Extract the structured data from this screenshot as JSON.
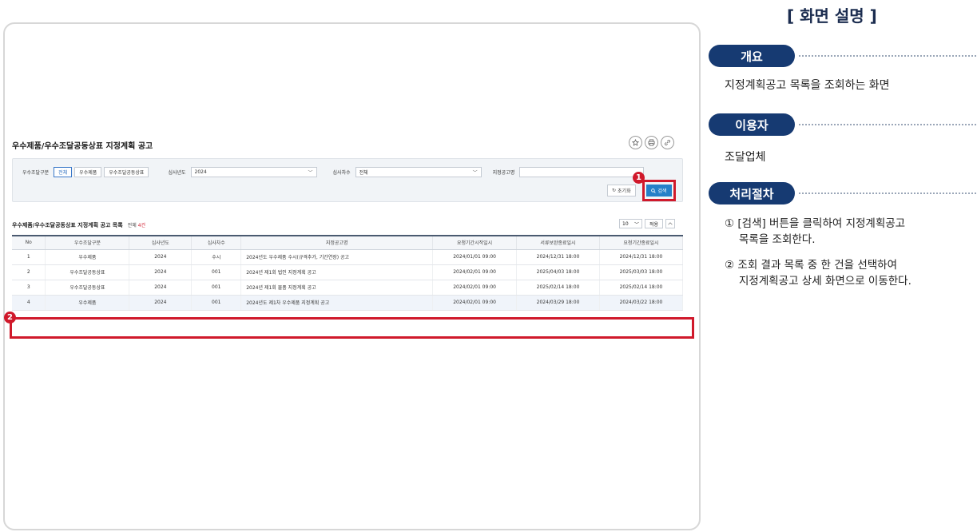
{
  "page": {
    "title": "우수제품/우수조달공동상표 지정계획 공고"
  },
  "search": {
    "category_label": "우수조달구분",
    "category_options": [
      "전체",
      "우수제품",
      "우수조달공동상표"
    ],
    "category_selected": "전체",
    "year_label": "심사년도",
    "year_value": "2024",
    "round_label": "심사차수",
    "round_value": "전체",
    "notice_name_label": "지정공고명",
    "notice_name_value": "",
    "reset_label": "초기화",
    "search_label": "검색"
  },
  "list": {
    "title": "우수제품/우수조달공동상표 지정계획 공고 목록",
    "count_prefix": "전체",
    "count_value": "4",
    "count_suffix": "건",
    "page_size": "10",
    "apply_label": "적용",
    "columns": [
      "No",
      "우수조달구분",
      "심사년도",
      "심사차수",
      "지정공고명",
      "요청기간시작일시",
      "서류보완종료일시",
      "요청기간종료일시"
    ],
    "rows": [
      [
        "1",
        "우수제품",
        "2024",
        "수시",
        "2024년도 우수제품 수시(규격추가, 기간연장) 공고",
        "2024/01/01 09:00",
        "2024/12/31 18:00",
        "2024/12/31 18:00"
      ],
      [
        "2",
        "우수조달공동상표",
        "2024",
        "001",
        "2024년 제1회 법인 지정계획 공고",
        "2024/02/01 09:00",
        "2025/04/03 18:00",
        "2025/03/03 18:00"
      ],
      [
        "3",
        "우수조달공동상표",
        "2024",
        "001",
        "2024년 제1회 물품 지정계획 공고",
        "2024/02/01 09:00",
        "2025/02/14 18:00",
        "2025/02/14 18:00"
      ],
      [
        "4",
        "우수제품",
        "2024",
        "001",
        "2024년도 제1차 우수제품 지정계획 공고",
        "2024/02/01 09:00",
        "2024/03/29 18:00",
        "2024/03/22 18:00"
      ]
    ]
  },
  "markers": {
    "one": "1",
    "two": "2"
  },
  "panel": {
    "heading": "[ 화면 설명 ]",
    "overview_label": "개요",
    "overview_text": "지정계획공고 목록을 조회하는 화면",
    "user_label": "이용자",
    "user_text": "조달업체",
    "process_label": "처리절차",
    "step1_line1": "① [검색] 버튼을 클릭하여 지정계획공고",
    "step1_line2": "목록을 조회한다.",
    "step2_line1": "② 조회 결과 목록 중 한 건을 선택하여",
    "step2_line2": "지정계획공고 상세 화면으로 이동한다."
  },
  "icons": [
    "star-icon",
    "print-icon",
    "link-icon",
    "refresh-icon",
    "search-icon",
    "chevron-down-icon",
    "chevron-up-icon"
  ],
  "colors": {
    "accent": "#2680c8",
    "highlight": "#d0192b",
    "navy": "#163a72"
  }
}
